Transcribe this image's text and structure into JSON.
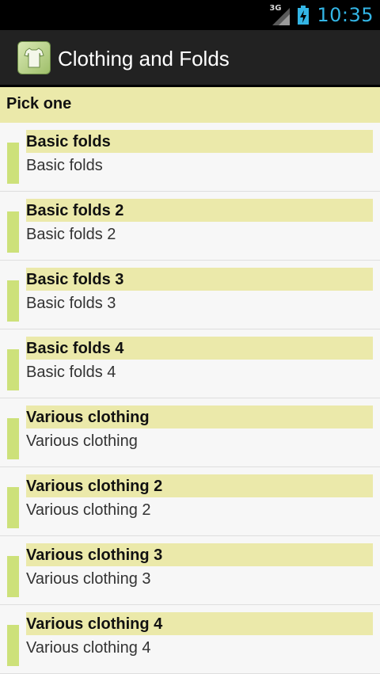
{
  "status_bar": {
    "network": "3G",
    "time": "10:35"
  },
  "action_bar": {
    "title": "Clothing and Folds",
    "icon": "shirt-icon"
  },
  "header": {
    "label": "Pick one"
  },
  "items": [
    {
      "title": "Basic folds",
      "subtitle": "Basic folds"
    },
    {
      "title": "Basic folds 2",
      "subtitle": "Basic folds 2"
    },
    {
      "title": "Basic folds 3",
      "subtitle": "Basic folds 3"
    },
    {
      "title": "Basic folds 4",
      "subtitle": "Basic folds 4"
    },
    {
      "title": "Various clothing",
      "subtitle": "Various clothing"
    },
    {
      "title": "Various clothing 2",
      "subtitle": "Various clothing 2"
    },
    {
      "title": "Various clothing 3",
      "subtitle": "Various clothing 3"
    },
    {
      "title": "Various clothing 4",
      "subtitle": "Various clothing 4"
    }
  ],
  "colors": {
    "accent_bar": "#cde17a",
    "highlight": "#ebe9aa",
    "clock": "#33b5e5"
  }
}
